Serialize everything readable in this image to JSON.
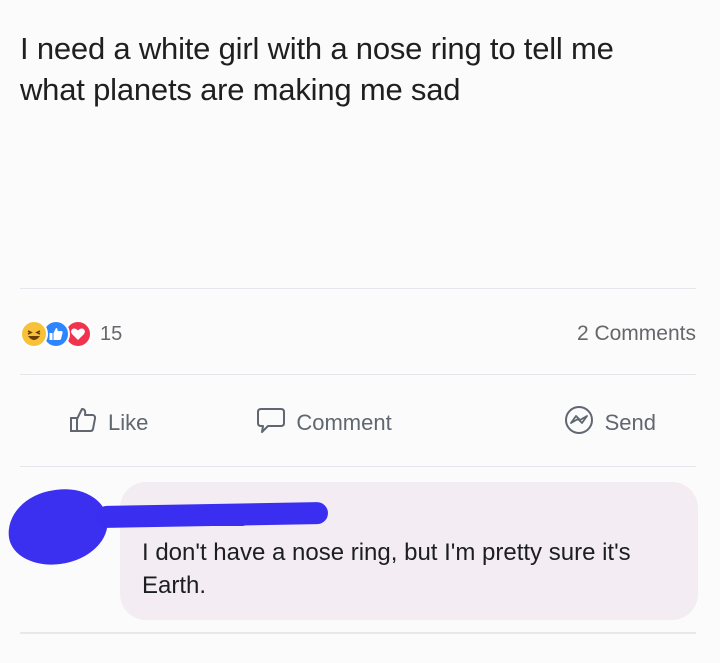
{
  "post": {
    "text": "I need a white girl with a nose ring to tell me what planets are making me sad"
  },
  "stats": {
    "reaction_icons": [
      "haha-icon",
      "like-icon",
      "love-icon"
    ],
    "reaction_count": "15",
    "comments_count": "2 Comments"
  },
  "actions": {
    "like_label": "Like",
    "comment_label": "Comment",
    "send_label": "Send"
  },
  "comment": {
    "text": "I don't have a nose ring, but I'm pretty sure it's Earth."
  },
  "colors": {
    "like_blue": "#2d86ff",
    "love_red": "#f0334f",
    "haha_yellow": "#f7c23a",
    "redaction_blue": "#3a2ff0",
    "bubble_bg": "#f3ecf3"
  }
}
